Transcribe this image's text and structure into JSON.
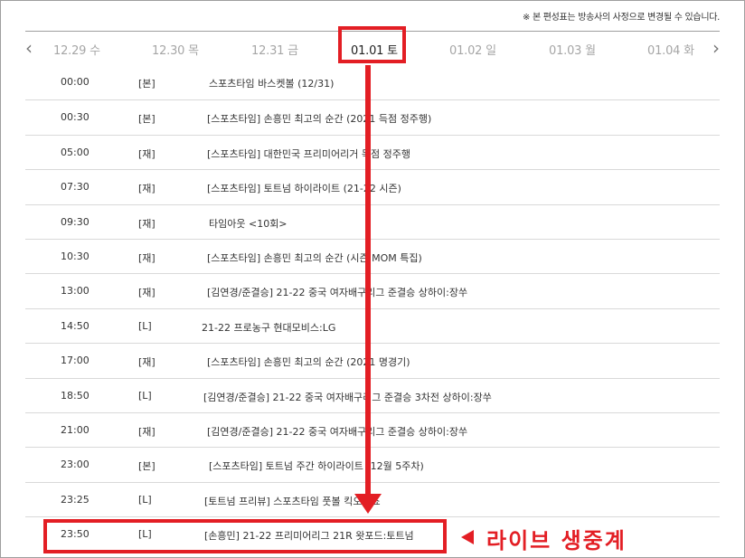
{
  "notice": "※ 본 편성표는 방송사의 사정으로 변경될 수 있습니다.",
  "colors": {
    "highlight": "#e31e24",
    "inactive_date": "#a6a6a6",
    "divider": "#d9d9d9"
  },
  "datebar": {
    "prev_icon": "chevron-left-icon",
    "next_icon": "chevron-right-icon",
    "dates": [
      {
        "label": "12.29 수",
        "active": false
      },
      {
        "label": "12.30 목",
        "active": false
      },
      {
        "label": "12.31 금",
        "active": false
      },
      {
        "label": "01.01 토",
        "active": true
      },
      {
        "label": "01.02 일",
        "active": false
      },
      {
        "label": "01.03 월",
        "active": false
      },
      {
        "label": "01.04 화",
        "active": false
      }
    ]
  },
  "schedule": [
    {
      "time": "00:00",
      "tag": "[본]",
      "title": "스포츠타임 바스켓볼 (12/31)"
    },
    {
      "time": "00:30",
      "tag": "[본]",
      "title": "[스포츠타임] 손흥민 최고의 순간 (2021 득점 정주행)"
    },
    {
      "time": "05:00",
      "tag": "[재]",
      "title": "[스포츠타임] 대한민국 프리미어리거 득점 정주행"
    },
    {
      "time": "07:30",
      "tag": "[재]",
      "title": "[스포츠타임] 토트넘 하이라이트 (21-22 시즌)"
    },
    {
      "time": "09:30",
      "tag": "[재]",
      "title": "타임아웃 <10회>"
    },
    {
      "time": "10:30",
      "tag": "[재]",
      "title": "[스포츠타임] 손흥민 최고의 순간 (시즌 MOM 특집)"
    },
    {
      "time": "13:00",
      "tag": "[재]",
      "title": "[김연경/준결승] 21-22 중국 여자배구리그 준결승 상하이:장쑤"
    },
    {
      "time": "14:50",
      "tag": "[L]",
      "title": "21-22 프로농구 현대모비스:LG"
    },
    {
      "time": "17:00",
      "tag": "[재]",
      "title": "[스포츠타임] 손흥민 최고의 순간 (2021 명경기)"
    },
    {
      "time": "18:50",
      "tag": "[L]",
      "title": "[김연경/준결승] 21-22 중국 여자배구리그 준결승 3차전 상하이:장쑤"
    },
    {
      "time": "21:00",
      "tag": "[재]",
      "title": "[김연경/준결승] 21-22 중국 여자배구리그 준결승 상하이:장쑤"
    },
    {
      "time": "23:00",
      "tag": "[본]",
      "title": "[스포츠타임] 토트넘 주간 하이라이트 (12월 5주차)"
    },
    {
      "time": "23:25",
      "tag": "[L]",
      "title": "[토트넘 프리뷰] 스포츠타임 풋볼 킥오프쇼"
    },
    {
      "time": "23:50",
      "tag": "[L]",
      "title": "[손흥민] 21-22 프리미어리그 21R 왓포드:토트넘"
    }
  ],
  "annotation": {
    "live_label": "라이브 생중계"
  }
}
